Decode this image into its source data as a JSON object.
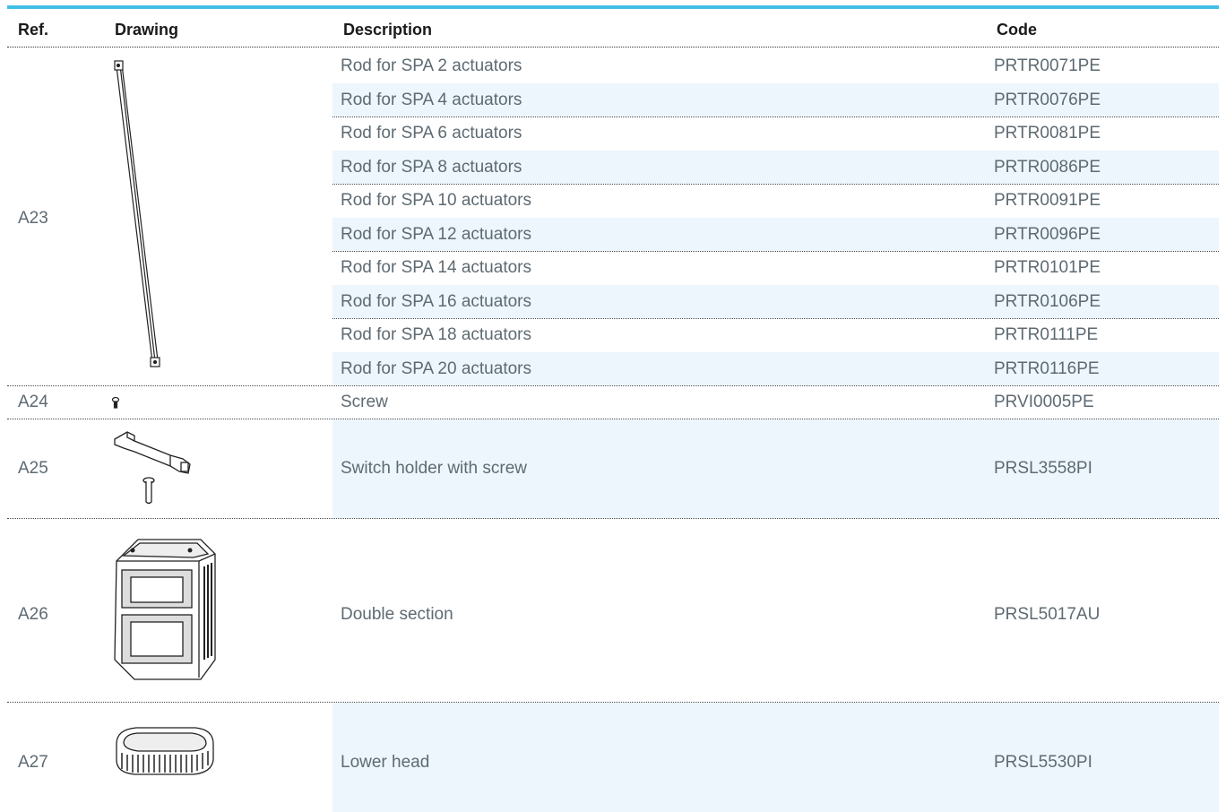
{
  "headers": {
    "ref": "Ref.",
    "drawing": "Drawing",
    "description": "Description",
    "code": "Code"
  },
  "groups": [
    {
      "ref": "A23",
      "drawing_icon": "rod-drawing-icon",
      "items": [
        {
          "description": "Rod for SPA 2 actuators",
          "code": "PRTR0071PE"
        },
        {
          "description": "Rod for SPA 4 actuators",
          "code": "PRTR0076PE"
        },
        {
          "description": "Rod for SPA 6 actuators",
          "code": "PRTR0081PE"
        },
        {
          "description": "Rod for SPA 8 actuators",
          "code": "PRTR0086PE"
        },
        {
          "description": "Rod for SPA 10 actuators",
          "code": "PRTR0091PE"
        },
        {
          "description": "Rod for SPA 12 actuators",
          "code": "PRTR0096PE"
        },
        {
          "description": "Rod for SPA 14 actuators",
          "code": "PRTR0101PE"
        },
        {
          "description": "Rod for SPA 16 actuators",
          "code": "PRTR0106PE"
        },
        {
          "description": "Rod for SPA 18 actuators",
          "code": "PRTR0111PE"
        },
        {
          "description": "Rod for SPA 20 actuators",
          "code": "PRTR0116PE"
        }
      ]
    },
    {
      "ref": "A24",
      "drawing_icon": "screw-drawing-icon",
      "items": [
        {
          "description": "Screw",
          "code": "PRVI0005PE"
        }
      ]
    },
    {
      "ref": "A25",
      "drawing_icon": "switch-holder-drawing-icon",
      "items": [
        {
          "description": "Switch holder with screw",
          "code": "PRSL3558PI"
        }
      ]
    },
    {
      "ref": "A26",
      "drawing_icon": "double-section-drawing-icon",
      "items": [
        {
          "description": "Double section",
          "code": "PRSL5017AU"
        }
      ]
    },
    {
      "ref": "A27",
      "drawing_icon": "lower-head-drawing-icon",
      "items": [
        {
          "description": "Lower head",
          "code": "PRSL5530PI"
        }
      ]
    }
  ],
  "colors": {
    "accent": "#41bfe6",
    "row_shade": "#edf6fc",
    "text": "#5e6a72"
  }
}
